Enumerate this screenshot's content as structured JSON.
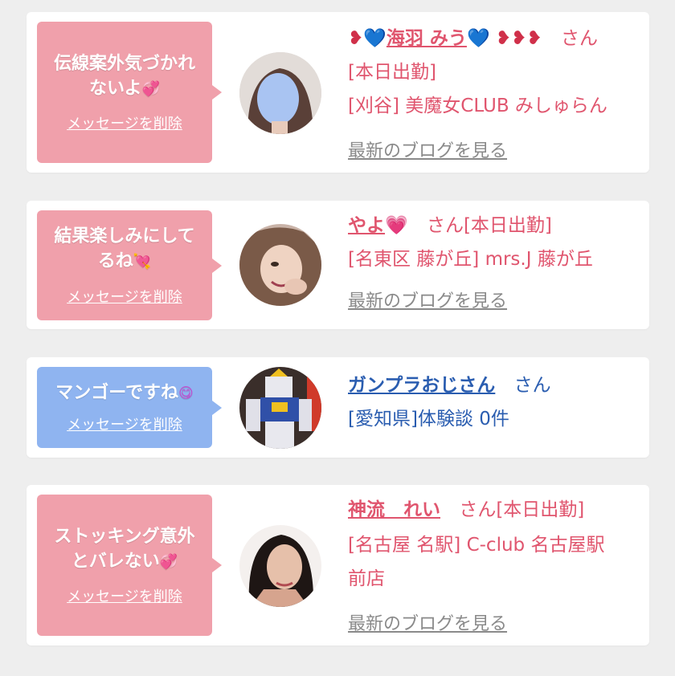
{
  "colors": {
    "pink_bubble": "#f0a0ab",
    "blue_bubble": "#8fb4f0",
    "pink_text": "#e0556e",
    "blue_text": "#2a5db0",
    "muted_text": "#8a8a8a"
  },
  "delete_label": "メッセージを削除",
  "blog_label": "最新のブログを見る",
  "san_label": "さん",
  "cards": [
    {
      "message_line1": "伝線案外気づかれ",
      "message_line2": "ないよ",
      "name": "海羽 みう",
      "status": "[本日出勤]",
      "shop": "[刈谷] 美魔女CLUB みしゅらん",
      "avatar_icon": "blurred-face-avatar"
    },
    {
      "message_line1": "結果楽しみにして",
      "message_line2": "るね",
      "name": "やよ",
      "status": "[本日出勤]",
      "shop": "[名東区 藤が丘] mrs.J 藤が丘",
      "avatar_icon": "woman-avatar"
    },
    {
      "message_line1": "マンゴーですね",
      "name": "ガンプラおじさん",
      "review": "[愛知県]体験談 0件",
      "avatar_icon": "gundam-model-avatar"
    },
    {
      "message_line1": "ストッキング意外",
      "message_line2": "とバレない",
      "name": "神流　れい",
      "status": "[本日出勤]",
      "shop_line1": "[名古屋 名駅] C-club 名古屋駅",
      "shop_line2": "前店",
      "avatar_icon": "woman-avatar"
    }
  ]
}
